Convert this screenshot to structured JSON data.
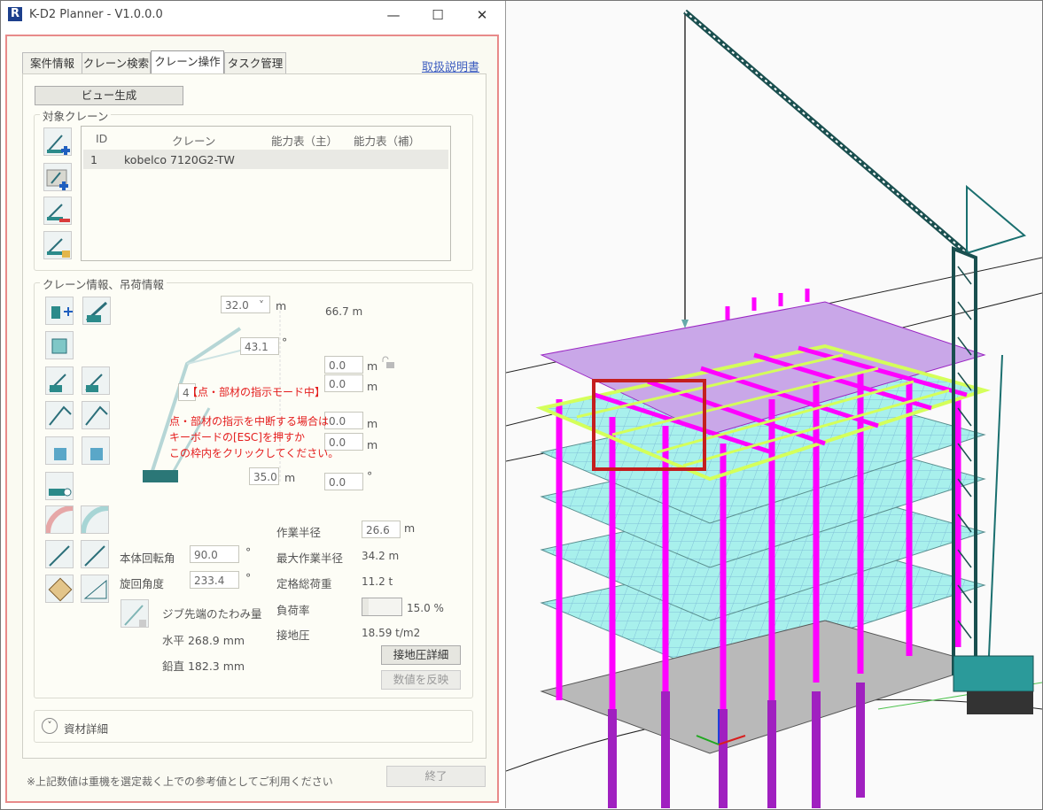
{
  "window": {
    "title": "K-D2 Planner - V1.0.0.0",
    "minimize": "—",
    "maximize": "☐",
    "close": "✕"
  },
  "tabs": [
    {
      "label": "案件情報"
    },
    {
      "label": "クレーン検索"
    },
    {
      "label": "クレーン操作"
    },
    {
      "label": "タスク管理"
    }
  ],
  "manual_link": "取扱説明書",
  "view_button": "ビュー生成",
  "target_crane": {
    "group_label": "対象クレーン",
    "headers": {
      "id": "ID",
      "crane": "クレーン",
      "cap_main": "能力表（主）",
      "cap_sub": "能力表（補）"
    },
    "rows": [
      {
        "id": "1",
        "crane": "kobelco 7120G2-TW"
      }
    ]
  },
  "crane_info": {
    "group_label": "クレーン情報、吊荷情報",
    "boom_length": "32.0",
    "boom_unit": "m",
    "height": "66.7 m",
    "angle": "43.1",
    "angle_unit": "°",
    "f1": "0.0",
    "f2": "0.0",
    "f3": "0.0",
    "f4": "0.0",
    "unit_m": "m",
    "left_partial": "4",
    "base_length": "35.0",
    "bottom_angle": "0.0",
    "deg": "°"
  },
  "mode_overlay": {
    "title": "【点・部材の指示モード中】",
    "line1": "点・部材の指示を中断する場合は",
    "line2": "キーボードの[ESC]を押すか",
    "line3": "この枠内をクリックしてください。"
  },
  "stats": {
    "body_rotation_label": "本体回転角",
    "body_rotation": "90.0",
    "swing_label": "旋回角度",
    "swing": "233.4",
    "deg": "°",
    "deflection_label": "ジブ先端のたわみ量",
    "horizontal": "水平 268.9 mm",
    "vertical": "鉛直 182.3 mm",
    "work_radius_label": "作業半径",
    "work_radius": "26.6",
    "work_radius_unit": "m",
    "max_radius_label": "最大作業半径",
    "max_radius": "34.2 m",
    "rated_load_label": "定格総荷重",
    "rated_load": "11.2 t",
    "load_rate_label": "負荷率",
    "load_rate": "15.0 %",
    "ground_pressure_label": "接地圧",
    "ground_pressure": "18.59 t/m2",
    "ground_detail_button": "接地圧詳細",
    "apply_button": "数値を反映"
  },
  "material_detail": "資材詳細",
  "footer_note": "※上記数値は重機を選定裁く上での参考値としてご利用ください",
  "end_button": "終了",
  "colors": {
    "accent_border": "#e88a8a",
    "overlay_text": "#e41c1c",
    "selection": "#c41e1e",
    "beam": "#ff00ff",
    "slab": "#9ff0ec",
    "crane": "#1a6f6f"
  }
}
